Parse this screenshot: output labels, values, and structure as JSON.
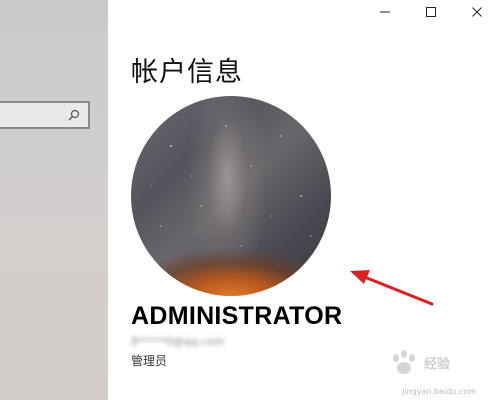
{
  "window": {
    "minimize_icon": "minimize-icon",
    "maximize_icon": "maximize-icon",
    "close_icon": "close-icon"
  },
  "sidebar": {
    "search_placeholder": "",
    "search_icon": "search-icon"
  },
  "main": {
    "title": "帐户信息",
    "account_name": "ADMINISTRATOR",
    "account_email": "8*****0@qq.com",
    "account_role": "管理员"
  },
  "watermark": {
    "brand": "Baidu 经验",
    "url": "jingyan.baidu.com"
  },
  "colors": {
    "arrow": "#e02020",
    "sidebar_bg": "#cfcdcd"
  }
}
